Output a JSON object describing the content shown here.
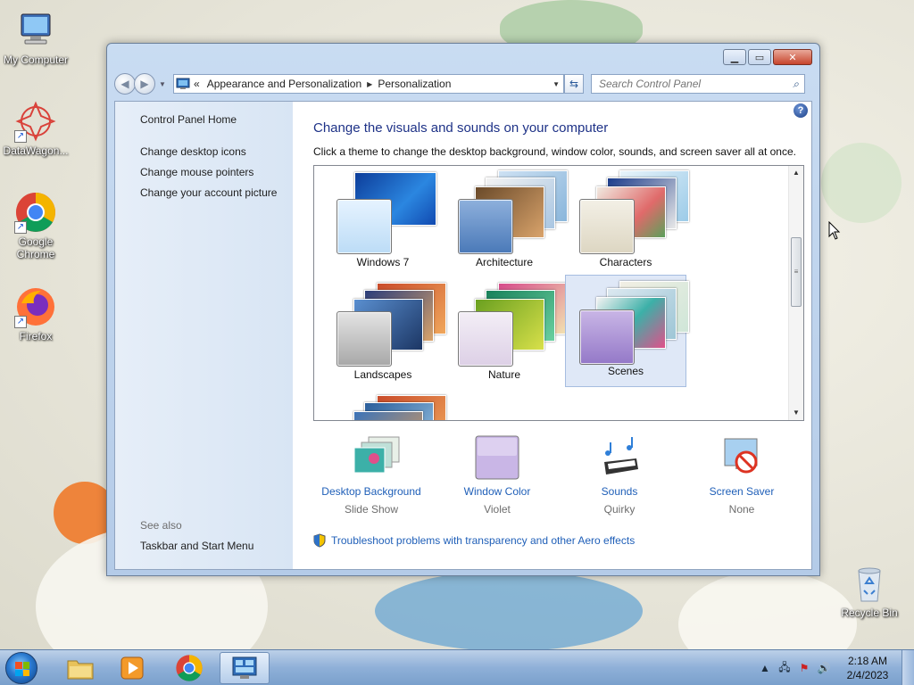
{
  "desktop": {
    "icons": [
      {
        "label": "My Computer"
      },
      {
        "label": "DataWagon..."
      },
      {
        "label": "Google Chrome"
      },
      {
        "label": "Firefox"
      },
      {
        "label": "Recycle Bin"
      }
    ]
  },
  "window": {
    "address": {
      "chevron": "«",
      "crumbs": [
        "Appearance and Personalization",
        "Personalization"
      ]
    },
    "search": {
      "placeholder": "Search Control Panel"
    },
    "left_pane": {
      "home": "Control Panel Home",
      "links": [
        "Change desktop icons",
        "Change mouse pointers",
        "Change your account picture"
      ],
      "see_also": "See also",
      "see_also_links": [
        "Taskbar and Start Menu"
      ]
    },
    "main": {
      "heading": "Change the visuals and sounds on your computer",
      "subtitle": "Click a theme to change the desktop background, window color, sounds, and screen saver all at once.",
      "themes": [
        {
          "name": "Windows 7",
          "selected": false
        },
        {
          "name": "Architecture",
          "selected": false
        },
        {
          "name": "Characters",
          "selected": false
        },
        {
          "name": "Landscapes",
          "selected": false
        },
        {
          "name": "Nature",
          "selected": false
        },
        {
          "name": "Scenes",
          "selected": true
        }
      ],
      "settings": [
        {
          "label": "Desktop Background",
          "value": "Slide Show"
        },
        {
          "label": "Window Color",
          "value": "Violet"
        },
        {
          "label": "Sounds",
          "value": "Quirky"
        },
        {
          "label": "Screen Saver",
          "value": "None"
        }
      ],
      "troubleshoot": "Troubleshoot problems with transparency and other Aero effects"
    }
  },
  "taskbar": {
    "clock_time": "2:18 AM",
    "clock_date": "2/4/2023"
  },
  "colors": {
    "link": "#1f5fb8",
    "heading": "#1e3287",
    "selected_theme": "#dfe8f7"
  }
}
